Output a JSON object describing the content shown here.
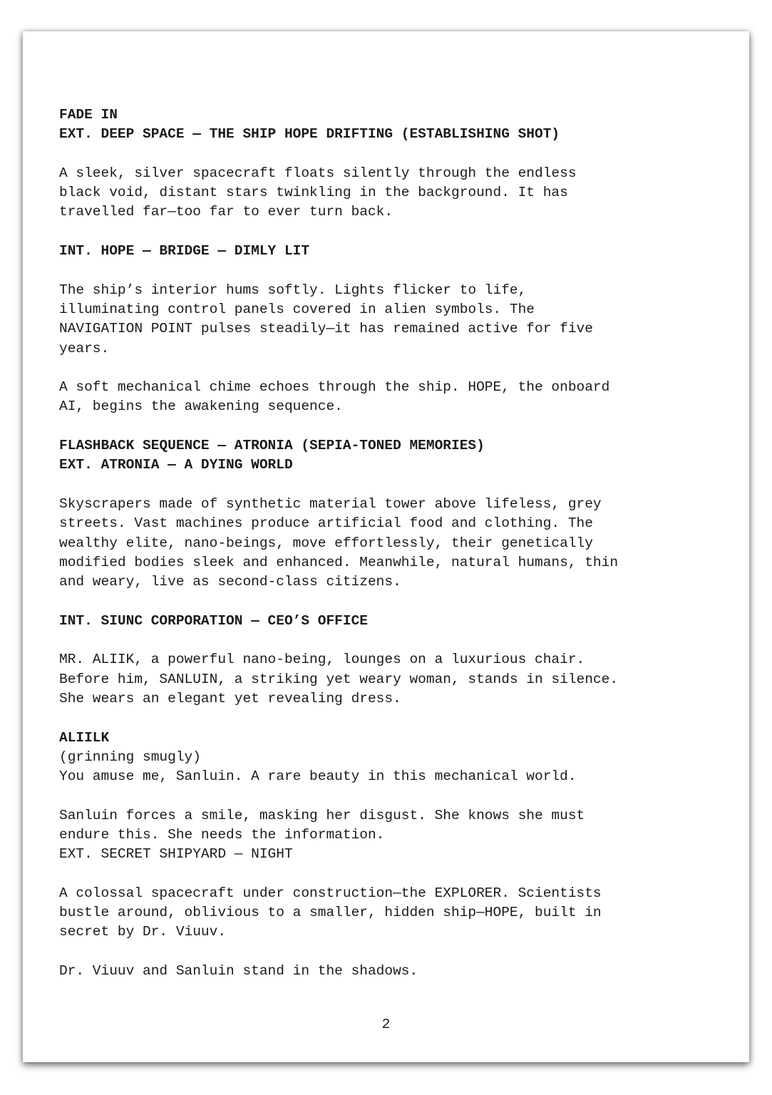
{
  "document": {
    "scene1": {
      "transition": "FADE IN",
      "heading": "EXT. DEEP SPACE — THE SHIP HOPE DRIFTING (ESTABLISHING SHOT)",
      "action": [
        "A sleek, silver spacecraft floats silently through the endless",
        "black void, distant stars twinkling in the background. It has",
        "travelled far—too far to ever turn back."
      ]
    },
    "scene2": {
      "heading": "INT. HOPE — BRIDGE — DIMLY LIT",
      "action1": [
        "The ship’s interior hums softly. Lights flicker to life,",
        "illuminating control panels covered in alien symbols. The",
        "NAVIGATION POINT pulses steadily—it has remained active for five",
        "years."
      ],
      "action2": [
        "A soft mechanical chime echoes through the ship. HOPE, the onboard",
        "AI, begins the awakening sequence."
      ]
    },
    "scene3": {
      "heading1": "FLASHBACK SEQUENCE — ATRONIA (SEPIA-TONED MEMORIES)",
      "heading2": "EXT. ATRONIA — A DYING WORLD",
      "action": [
        "Skyscrapers made of synthetic material tower above lifeless, grey",
        "streets. Vast machines produce artificial food and clothing. The",
        "wealthy elite, nano-beings, move effortlessly, their genetically",
        "modified bodies sleek and enhanced. Meanwhile, natural humans, thin",
        "and weary, live as second-class citizens."
      ]
    },
    "scene4": {
      "heading": "INT. SIUNC CORPORATION — CEO’S OFFICE",
      "action": [
        "MR. ALIIK, a powerful nano-being, lounges on a luxurious chair.",
        "Before him, SANLUIN, a striking yet weary woman, stands in silence.",
        "She wears an elegant yet revealing dress."
      ],
      "character": "ALIILK",
      "parenthetical": "(grinning smugly)",
      "dialogue": "You amuse me, Sanluin. A rare beauty in this mechanical world.",
      "action2": [
        "Sanluin forces a smile, masking her disgust. She knows she must",
        "endure this. She needs the information."
      ]
    },
    "scene5": {
      "heading": "EXT. SECRET SHIPYARD — NIGHT",
      "action1": [
        "A colossal spacecraft under construction—the EXPLORER. Scientists",
        "bustle around, oblivious to a smaller, hidden ship—HOPE, built in",
        "secret by Dr. Viuuv."
      ],
      "action2": "Dr. Viuuv and Sanluin stand in the shadows."
    },
    "page_number": "2"
  }
}
